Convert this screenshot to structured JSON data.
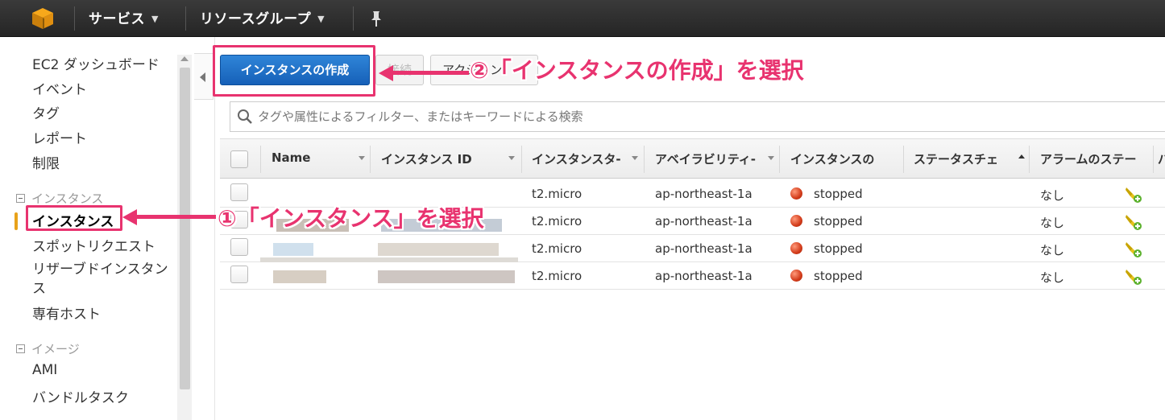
{
  "topnav": {
    "services_label": "サービス",
    "resource_groups_label": "リソースグループ"
  },
  "sidebar": {
    "items": [
      {
        "label": "EC2 ダッシュボード"
      },
      {
        "label": "イベント"
      },
      {
        "label": "タグ"
      },
      {
        "label": "レポート"
      },
      {
        "label": "制限"
      }
    ],
    "instances_group": {
      "title": "インスタンス",
      "items": [
        {
          "label": "インスタンス",
          "active": true
        },
        {
          "label": "スポットリクエスト"
        },
        {
          "label": "リザーブドインスタンス"
        },
        {
          "label": "専有ホスト"
        }
      ]
    },
    "images_group": {
      "title": "イメージ",
      "items": [
        {
          "label": "AMI"
        },
        {
          "label": "バンドルタスク"
        }
      ]
    }
  },
  "toolbar": {
    "create_label": "インスタンスの作成",
    "connect_label": "接続",
    "actions_label": "アクション"
  },
  "search": {
    "placeholder": "タグや属性によるフィルター、またはキーワードによる検索"
  },
  "table": {
    "columns": [
      "Name",
      "インスタンス ID",
      "インスタンスタ-",
      "アベイラビリティ-",
      "インスタンスの",
      "ステータスチェ",
      "アラームのステー",
      "パ"
    ],
    "rows": [
      {
        "type": "t2.micro",
        "zone": "ap-northeast-1a",
        "state": "stopped",
        "alarm": "なし"
      },
      {
        "type": "t2.micro",
        "zone": "ap-northeast-1a",
        "state": "stopped",
        "alarm": "なし"
      },
      {
        "type": "t2.micro",
        "zone": "ap-northeast-1a",
        "state": "stopped",
        "alarm": "なし"
      },
      {
        "type": "t2.micro",
        "zone": "ap-northeast-1a",
        "state": "stopped",
        "alarm": "なし"
      }
    ]
  },
  "annotations": {
    "step1": "①「インスタンス」を選択",
    "step2": "②「インスタンスの作成」を選択",
    "color": "#e8336f"
  }
}
